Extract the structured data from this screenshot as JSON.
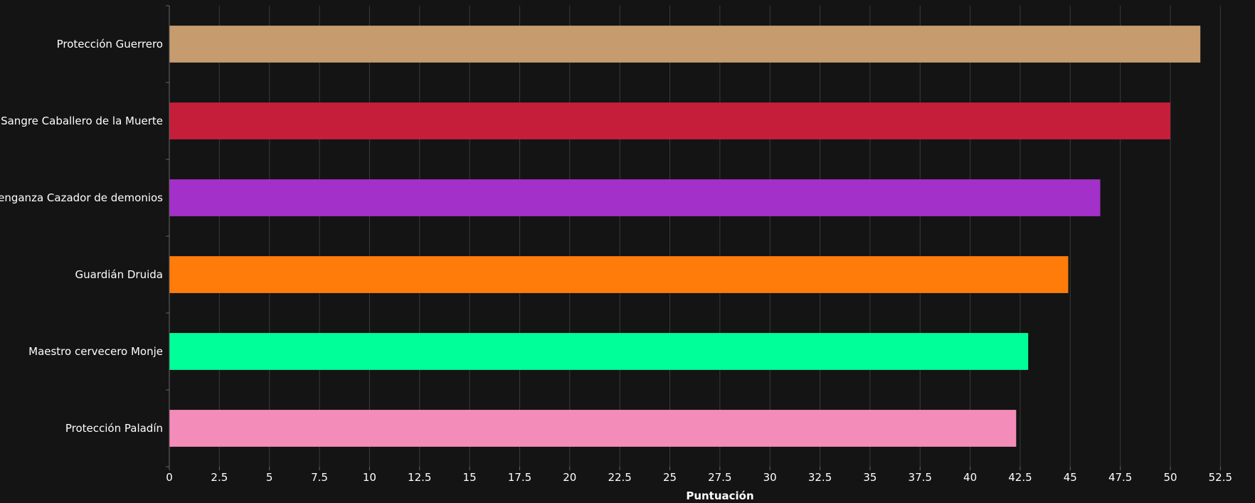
{
  "chart_data": {
    "type": "bar",
    "orientation": "horizontal",
    "categories": [
      "Protección Guerrero",
      "Sangre Caballero de la Muerte",
      "Venganza Cazador de demonios",
      "Guardián Druida",
      "Maestro cervecero Monje",
      "Protección Paladín"
    ],
    "values": [
      51.5,
      50.0,
      46.5,
      44.9,
      42.9,
      42.3
    ],
    "colors": [
      "#C69B6D",
      "#C41E3A",
      "#A330C9",
      "#FF7C0A",
      "#00FF98",
      "#F48CBA"
    ],
    "title": "",
    "xlabel": "Puntuación",
    "ylabel": "",
    "xlim": [
      0,
      53.5
    ],
    "xticks": [
      0,
      2.5,
      5,
      7.5,
      10,
      12.5,
      15,
      17.5,
      20,
      22.5,
      25,
      27.5,
      30,
      32.5,
      35,
      37.5,
      40,
      42.5,
      45,
      47.5,
      50,
      52.5
    ],
    "tick_labels": [
      "0",
      "2.5",
      "5",
      "7.5",
      "10",
      "12.5",
      "15",
      "17.5",
      "20",
      "22.5",
      "25",
      "27.5",
      "30",
      "32.5",
      "35",
      "37.5",
      "40",
      "42.5",
      "45",
      "47.5",
      "50",
      "52.5"
    ],
    "grid": true,
    "legend": "none"
  }
}
